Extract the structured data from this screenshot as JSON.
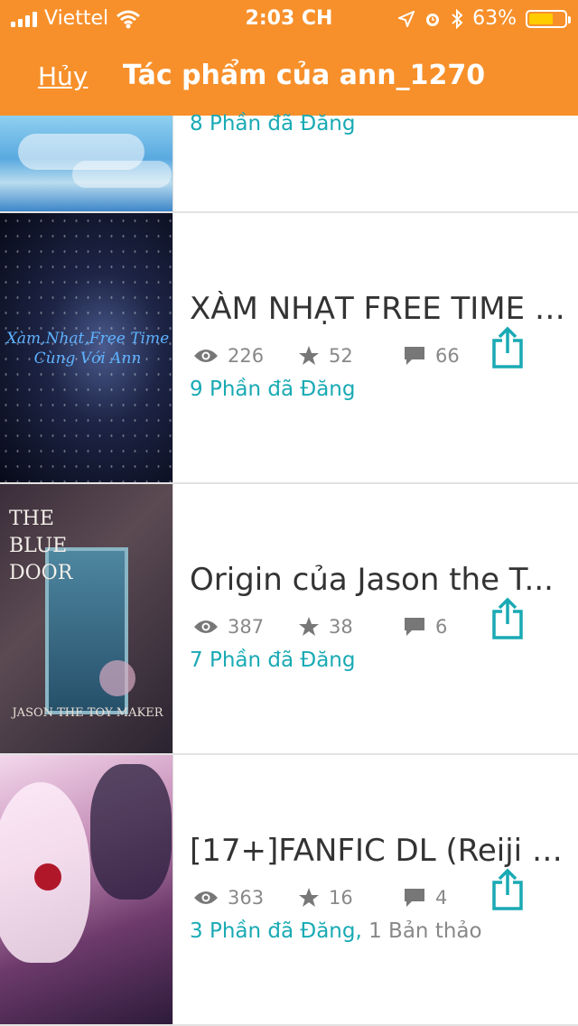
{
  "status_bar": {
    "carrier": "Viettel",
    "time": "2:03 CH",
    "battery_percent": "63%"
  },
  "nav": {
    "cancel_label": "Hủy",
    "title": "Tác phẩm của ann_1270"
  },
  "stories": [
    {
      "title": "",
      "parts_label": "8 Phần đã Đăng",
      "cover_text": ""
    },
    {
      "title": "XÀM NHẠT FREE TIME c...",
      "reads": "226",
      "votes": "52",
      "comments": "66",
      "parts_label": "9 Phần đã Đăng",
      "cover_text": "Xàm,Nhạt,Free Time Cùng Với Ann"
    },
    {
      "title": "Origin của Jason the T...",
      "reads": "387",
      "votes": "38",
      "comments": "6",
      "parts_label": "7 Phần đã Đăng",
      "cover_text": "THE BLUE DOOR",
      "cover_sub": "JASON THE TOY MAKER"
    },
    {
      "title": "[17+]FANFIC DL (Reiji x...",
      "reads": "363",
      "votes": "16",
      "comments": "4",
      "parts_label": "3 Phần đã Đăng,",
      "draft_label": "1 Bản thảo"
    }
  ],
  "colors": {
    "header_bg": "#f7902b",
    "accent": "#19aab4",
    "text": "#333333",
    "muted": "#888888"
  }
}
